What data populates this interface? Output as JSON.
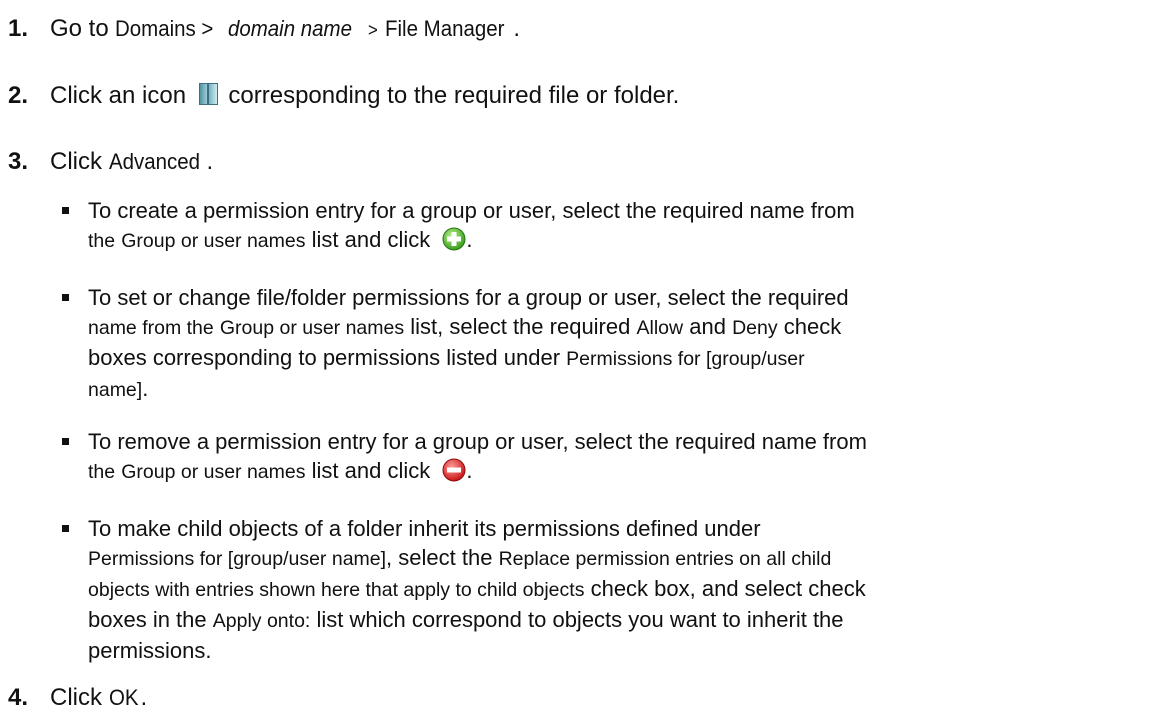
{
  "steps": [
    {
      "number": "1.",
      "lead": "Go to",
      "path_domains": "Domains >",
      "path_domain_name": "domain name",
      "path_sep": ">",
      "path_file_manager": "File Manager",
      "end": "."
    },
    {
      "number": "2.",
      "text_before_icon": "Click an icon",
      "text_after_icon": "corresponding to the required file or folder.",
      "icon": "folder-permissions-icon"
    },
    {
      "number": "3.",
      "lead": "Click",
      "ui_label": "Advanced",
      "end": "."
    },
    {
      "number": "4.",
      "lead": "Click",
      "ui_label": "OK",
      "end": "."
    }
  ],
  "bullets": [
    {
      "line1": "To create a permission entry for a group or user, select the required name from",
      "the": "the",
      "ui_list": "Group or user names",
      "after": "list and click",
      "icon": "plus-icon",
      "end": "."
    },
    {
      "line1": "To set or change file/folder permissions for a group or user, select the required",
      "name_from": "name from the",
      "ui_list": "Group or user names",
      "list_select": "list, select the required",
      "ui_allow": "Allow",
      "and": "and",
      "ui_deny": "Deny",
      "check": "check",
      "line3": "boxes corresponding to permissions listed under",
      "ui_permissions": "Permissions for [group/user",
      "ui_name": "name]",
      "end": "."
    },
    {
      "line1": "To remove a permission entry for a group or user, select the required name from",
      "the": "the",
      "ui_list": "Group or user names",
      "after": "list and click",
      "icon": "minus-icon",
      "end": "."
    },
    {
      "line1": "To make child objects of a folder inherit its permissions defined under",
      "ui_permissions": "Permissions for [group/user name]",
      "select_the": ", select the",
      "ui_replace1": "Replace permission entries on all child",
      "ui_replace2": "objects with entries shown here that apply to child objects",
      "check_box": "check box, and select check",
      "boxes_in": "boxes in the",
      "ui_apply": "Apply onto:",
      "list_which": "list which correspond to objects you want to inherit the",
      "permissions": "permissions."
    }
  ]
}
